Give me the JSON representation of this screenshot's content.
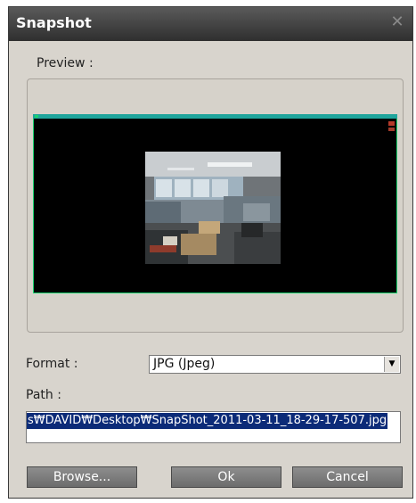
{
  "dialog": {
    "title": "Snapshot"
  },
  "preview": {
    "label": "Preview :"
  },
  "format": {
    "label": "Format :",
    "selected": "JPG (Jpeg)"
  },
  "path": {
    "label": "Path :",
    "value": "s₩DAVID₩Desktop₩SnapShot_2011-03-11_18-29-17-507.jpg"
  },
  "buttons": {
    "browse": "Browse...",
    "ok": "Ok",
    "cancel": "Cancel"
  },
  "icons": {
    "close": "close-icon",
    "dropdown": "chevron-down-icon"
  },
  "colors": {
    "titlebar": "#2f2f2f",
    "dialog_bg": "#d8d4cd",
    "video_top_bar": "#1fa59c",
    "video_border": "#1ad36e",
    "selection": "#0c2b78",
    "button": "#7a7a7a"
  }
}
